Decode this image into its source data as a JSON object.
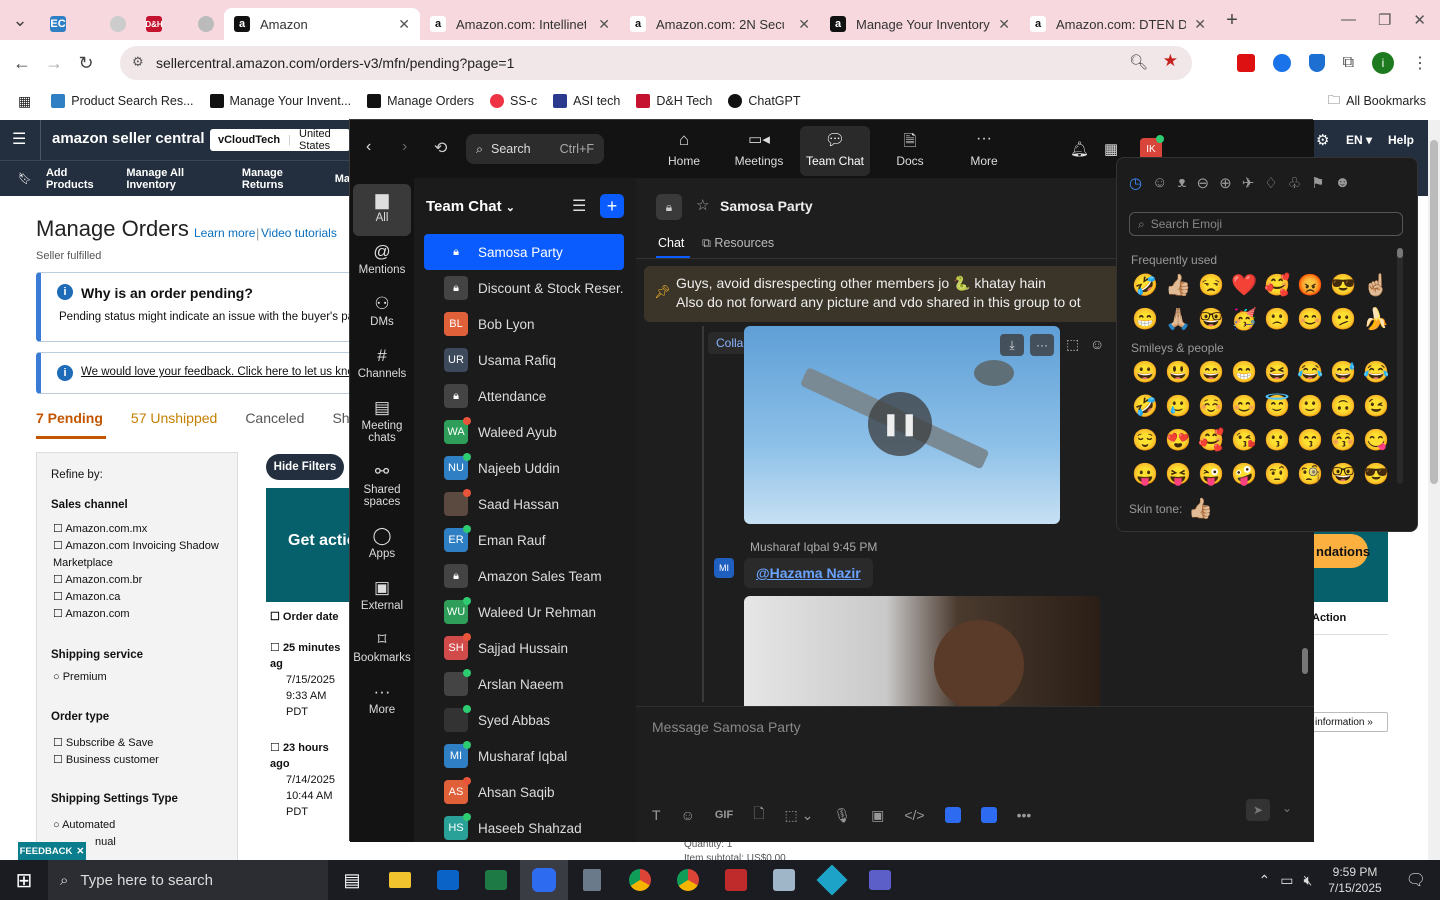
{
  "browser": {
    "tabs": [
      {
        "title": "Amazon",
        "active": true
      },
      {
        "title": "Amazon.com: Intellinet"
      },
      {
        "title": "Amazon.com: 2N Securi"
      },
      {
        "title": "Manage Your Inventory"
      },
      {
        "title": "Amazon.com: DTEN D7"
      }
    ],
    "url": "sellercentral.amazon.com/orders-v3/mfn/pending?page=1",
    "bookmarks": [
      "Product Search Res...",
      "Manage Your Invent...",
      "Manage Orders",
      "SS-c",
      "ASI tech",
      "D&H Tech",
      "ChatGPT"
    ],
    "all_bookmarks": "All Bookmarks",
    "profile_initial": "i"
  },
  "seller": {
    "logo": "amazon seller central",
    "account": "vCloudTech",
    "marketplace": "United States",
    "nav": [
      "Add Products",
      "Manage All Inventory",
      "Manage Returns",
      "Ma"
    ],
    "title": "Manage Orders",
    "learn_more": "Learn more",
    "video": "Video tutorials",
    "subtitle": "Seller fulfilled",
    "pending_q": "Why is an order pending?",
    "pending_text": "Pending status might indicate an issue with the buyer's pa",
    "feedback": "We would love your feedback. Click here to let us kno",
    "tabs": [
      "7 Pending",
      "57 Unshipped",
      "Canceled",
      "Sh"
    ],
    "refine": "Refine by:",
    "hide_filters": "Hide Filters",
    "sales_channel": "Sales channel",
    "channels": [
      "Amazon.com.mx",
      "Amazon.com Invoicing Shadow Marketplace",
      "Amazon.com.br",
      "Amazon.ca",
      "Amazon.com"
    ],
    "shipping_service": "Shipping service",
    "premium": "Premium",
    "order_type": "Order type",
    "order_types": [
      "Subscribe & Save",
      "Business customer"
    ],
    "settings_type": "Shipping Settings Type",
    "automated": "Automated",
    "manual": "nual",
    "get_action": "Get actio",
    "order_date": "Order date",
    "order1": {
      "age": "25 minutes ag",
      "date": "7/15/2025",
      "time": "9:33 AM PDT"
    },
    "order2": {
      "age": "23 hours ago",
      "date": "7/14/2025",
      "time": "10:44 AM PDT"
    },
    "feedback_tab": "FEEDBACK",
    "right_help": "Help",
    "right_lang": "EN",
    "right_banner": "ndations",
    "right_action": "Action",
    "right_info": "information »",
    "qty": "Quantity: 1",
    "subtotal": "Item subtotal: US$0.00"
  },
  "zoom": {
    "search": "Search",
    "shortcut": "Ctrl+F",
    "top_nav": [
      "Home",
      "Meetings",
      "Team Chat",
      "Docs",
      "More"
    ],
    "user_initials": "IK",
    "rail": [
      {
        "label": "All",
        "icon": "chat-icon"
      },
      {
        "label": "Mentions",
        "icon": "at-icon"
      },
      {
        "label": "DMs",
        "icon": "people-icon"
      },
      {
        "label": "Channels",
        "icon": "hash-icon"
      },
      {
        "label": "Meeting chats",
        "icon": "calendar-icon"
      },
      {
        "label": "Shared spaces",
        "icon": "share-icon"
      },
      {
        "label": "Apps",
        "icon": "apps-icon"
      },
      {
        "label": "External",
        "icon": "external-icon"
      },
      {
        "label": "Bookmarks",
        "icon": "bookmark-icon"
      },
      {
        "label": "More",
        "icon": "more-icon"
      }
    ],
    "list_title": "Team Chat",
    "chats": [
      {
        "name": "Samosa Party",
        "av": "",
        "type": "lock",
        "color": "#0b5cff"
      },
      {
        "name": "Discount & Stock Reser...",
        "av": "",
        "type": "lock",
        "color": "#444"
      },
      {
        "name": "Bob Lyon",
        "av": "BL",
        "color": "#e0603a"
      },
      {
        "name": "Usama Rafiq",
        "av": "UR",
        "color": "#3d4a5c"
      },
      {
        "name": "Attendance",
        "av": "",
        "type": "lock",
        "color": "#444"
      },
      {
        "name": "Waleed Ayub",
        "av": "WA",
        "color": "#2e9e5a"
      },
      {
        "name": "Najeeb Uddin",
        "av": "NU",
        "color": "#2f7fc4"
      },
      {
        "name": "Saad Hassan",
        "av": "",
        "color": "#5a4a40"
      },
      {
        "name": "Eman Rauf",
        "av": "ER",
        "color": "#2f7fc4"
      },
      {
        "name": "Amazon Sales Team",
        "av": "",
        "type": "lock",
        "color": "#444"
      },
      {
        "name": "Waleed Ur Rehman",
        "av": "WU",
        "color": "#2e9e5a"
      },
      {
        "name": "Sajjad Hussain",
        "av": "SH",
        "color": "#d24b4b"
      },
      {
        "name": "Arslan Naeem",
        "av": "",
        "color": "#444"
      },
      {
        "name": "Syed Abbas",
        "av": "",
        "color": "#333"
      },
      {
        "name": "Musharaf Iqbal",
        "av": "MI",
        "color": "#2f7fc4"
      },
      {
        "name": "Ahsan Saqib",
        "av": "AS",
        "color": "#e0603a"
      },
      {
        "name": "Haseeb Shahzad",
        "av": "HS",
        "color": "#2aa198"
      }
    ],
    "channel": "Samosa Party",
    "tab_chat": "Chat",
    "tab_resources": "Resources",
    "pinned_line1": "Guys, avoid disrespecting other members jo 🐍 khatay hain",
    "pinned_line2": "Also do not forward any picture and vdo shared in this group to ot",
    "collapse_all": "Collapse all",
    "sender": "Musharaf Iqbal",
    "sender_initials": "MI",
    "sender_time": "9:45 PM",
    "mention": "@Hazama Nazir",
    "composer_placeholder": "Message Samosa Party",
    "gif": "GIF"
  },
  "emoji": {
    "search_placeholder": "Search Emoji",
    "frequent_title": "Frequently used",
    "frequent": [
      "🤣",
      "👍🏼",
      "😒",
      "❤️",
      "🥰",
      "😡",
      "😎",
      "☝🏼",
      "😁",
      "🙏🏼",
      "🤓",
      "🥳",
      "🙁",
      "😊",
      "🫤",
      "🍌"
    ],
    "smileys_title": "Smileys & people",
    "smileys": [
      "😀",
      "😃",
      "😄",
      "😁",
      "😆",
      "😂",
      "😅",
      "😂",
      "🤣",
      "🥲",
      "☺️",
      "😊",
      "😇",
      "🙂",
      "🙃",
      "😉",
      "😌",
      "😍",
      "🥰",
      "😘",
      "😗",
      "😙",
      "😚",
      "😋",
      "😛",
      "😝",
      "😜",
      "🤪",
      "🤨",
      "🧐",
      "🤓",
      "😎"
    ],
    "skin_tone_label": "Skin tone:",
    "skin_tone": "👍🏼"
  },
  "taskbar": {
    "search": "Type here to search",
    "time": "9:59 PM",
    "date": "7/15/2025"
  },
  "colors": {
    "zoom_blue": "#0b5cff",
    "amazon_navy": "#232f3e",
    "pink_chrome": "#f6d8de"
  }
}
